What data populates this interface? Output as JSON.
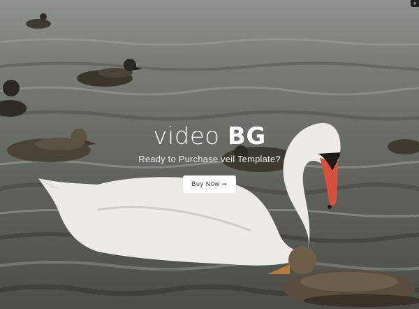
{
  "hero": {
    "title_light": "video",
    "title_bold": "BG",
    "subtitle": "Ready to Purchase veil Template?",
    "button_label": "Buy Now",
    "button_arrow": "➞"
  },
  "corner_widget": {
    "icon": "plus-icon",
    "glyph": "+"
  },
  "colors": {
    "overlay_text": "#ffffff",
    "button_bg": "#ffffff",
    "button_text": "#333333"
  }
}
